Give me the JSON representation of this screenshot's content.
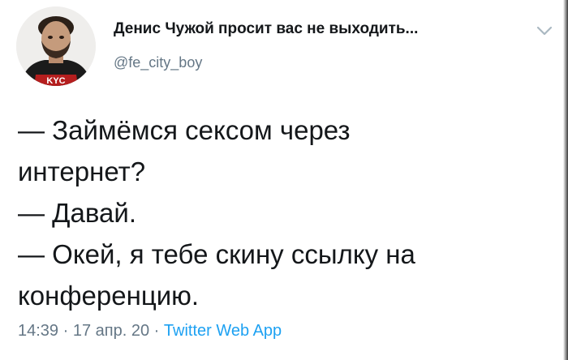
{
  "author": {
    "display_name": "Денис Чужой просит вас не выходить...",
    "handle": "@fe_city_boy",
    "avatar_shirt_text": "KYC"
  },
  "tweet": {
    "lines": [
      "— Займёмся сексом через",
      "интернет?",
      "— Давай.",
      "— Окей, я тебе скину ссылку на",
      "конференцию."
    ],
    "time": "14:39",
    "separator": "·",
    "date": "17 апр. 20",
    "source": "Twitter Web App"
  },
  "icons": {
    "menu": "chevron-down-icon"
  },
  "colors": {
    "text": "#14171a",
    "secondary": "#657786",
    "link": "#1da1f2"
  }
}
